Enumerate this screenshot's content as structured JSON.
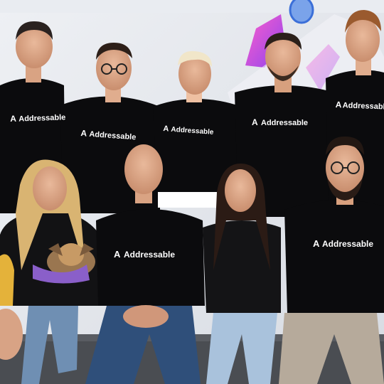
{
  "brand": {
    "name": "Addressable",
    "mark": "A",
    "colors": {
      "mark_left": "#ff3d7f",
      "mark_right": "#6a5cff",
      "shirt": "#0b0b0d",
      "backdrop": "#e4e7ec",
      "sofa": "#4a4d52",
      "decal_pink": "#d94bd1",
      "decal_blue": "#3b6fd8"
    }
  },
  "people": [
    {
      "id": "back-1",
      "row": "back",
      "shirt_logo": "Addressable"
    },
    {
      "id": "back-2",
      "row": "back",
      "shirt_logo": "Addressable"
    },
    {
      "id": "back-3",
      "row": "back",
      "shirt_logo": "Addressable"
    },
    {
      "id": "back-4",
      "row": "back",
      "shirt_logo": "Addressable"
    },
    {
      "id": "back-5",
      "row": "back",
      "shirt_logo": "Addressable"
    },
    {
      "id": "front-1",
      "row": "front",
      "shirt_logo": ""
    },
    {
      "id": "front-2",
      "row": "front",
      "shirt_logo": "Addressable"
    },
    {
      "id": "front-3",
      "row": "front",
      "shirt_logo": ""
    },
    {
      "id": "front-4",
      "row": "front",
      "shirt_logo": "Addressable"
    }
  ],
  "props": {
    "dog": "small dog in purple scarf",
    "decal_icon": "rocket-decal-icon"
  }
}
